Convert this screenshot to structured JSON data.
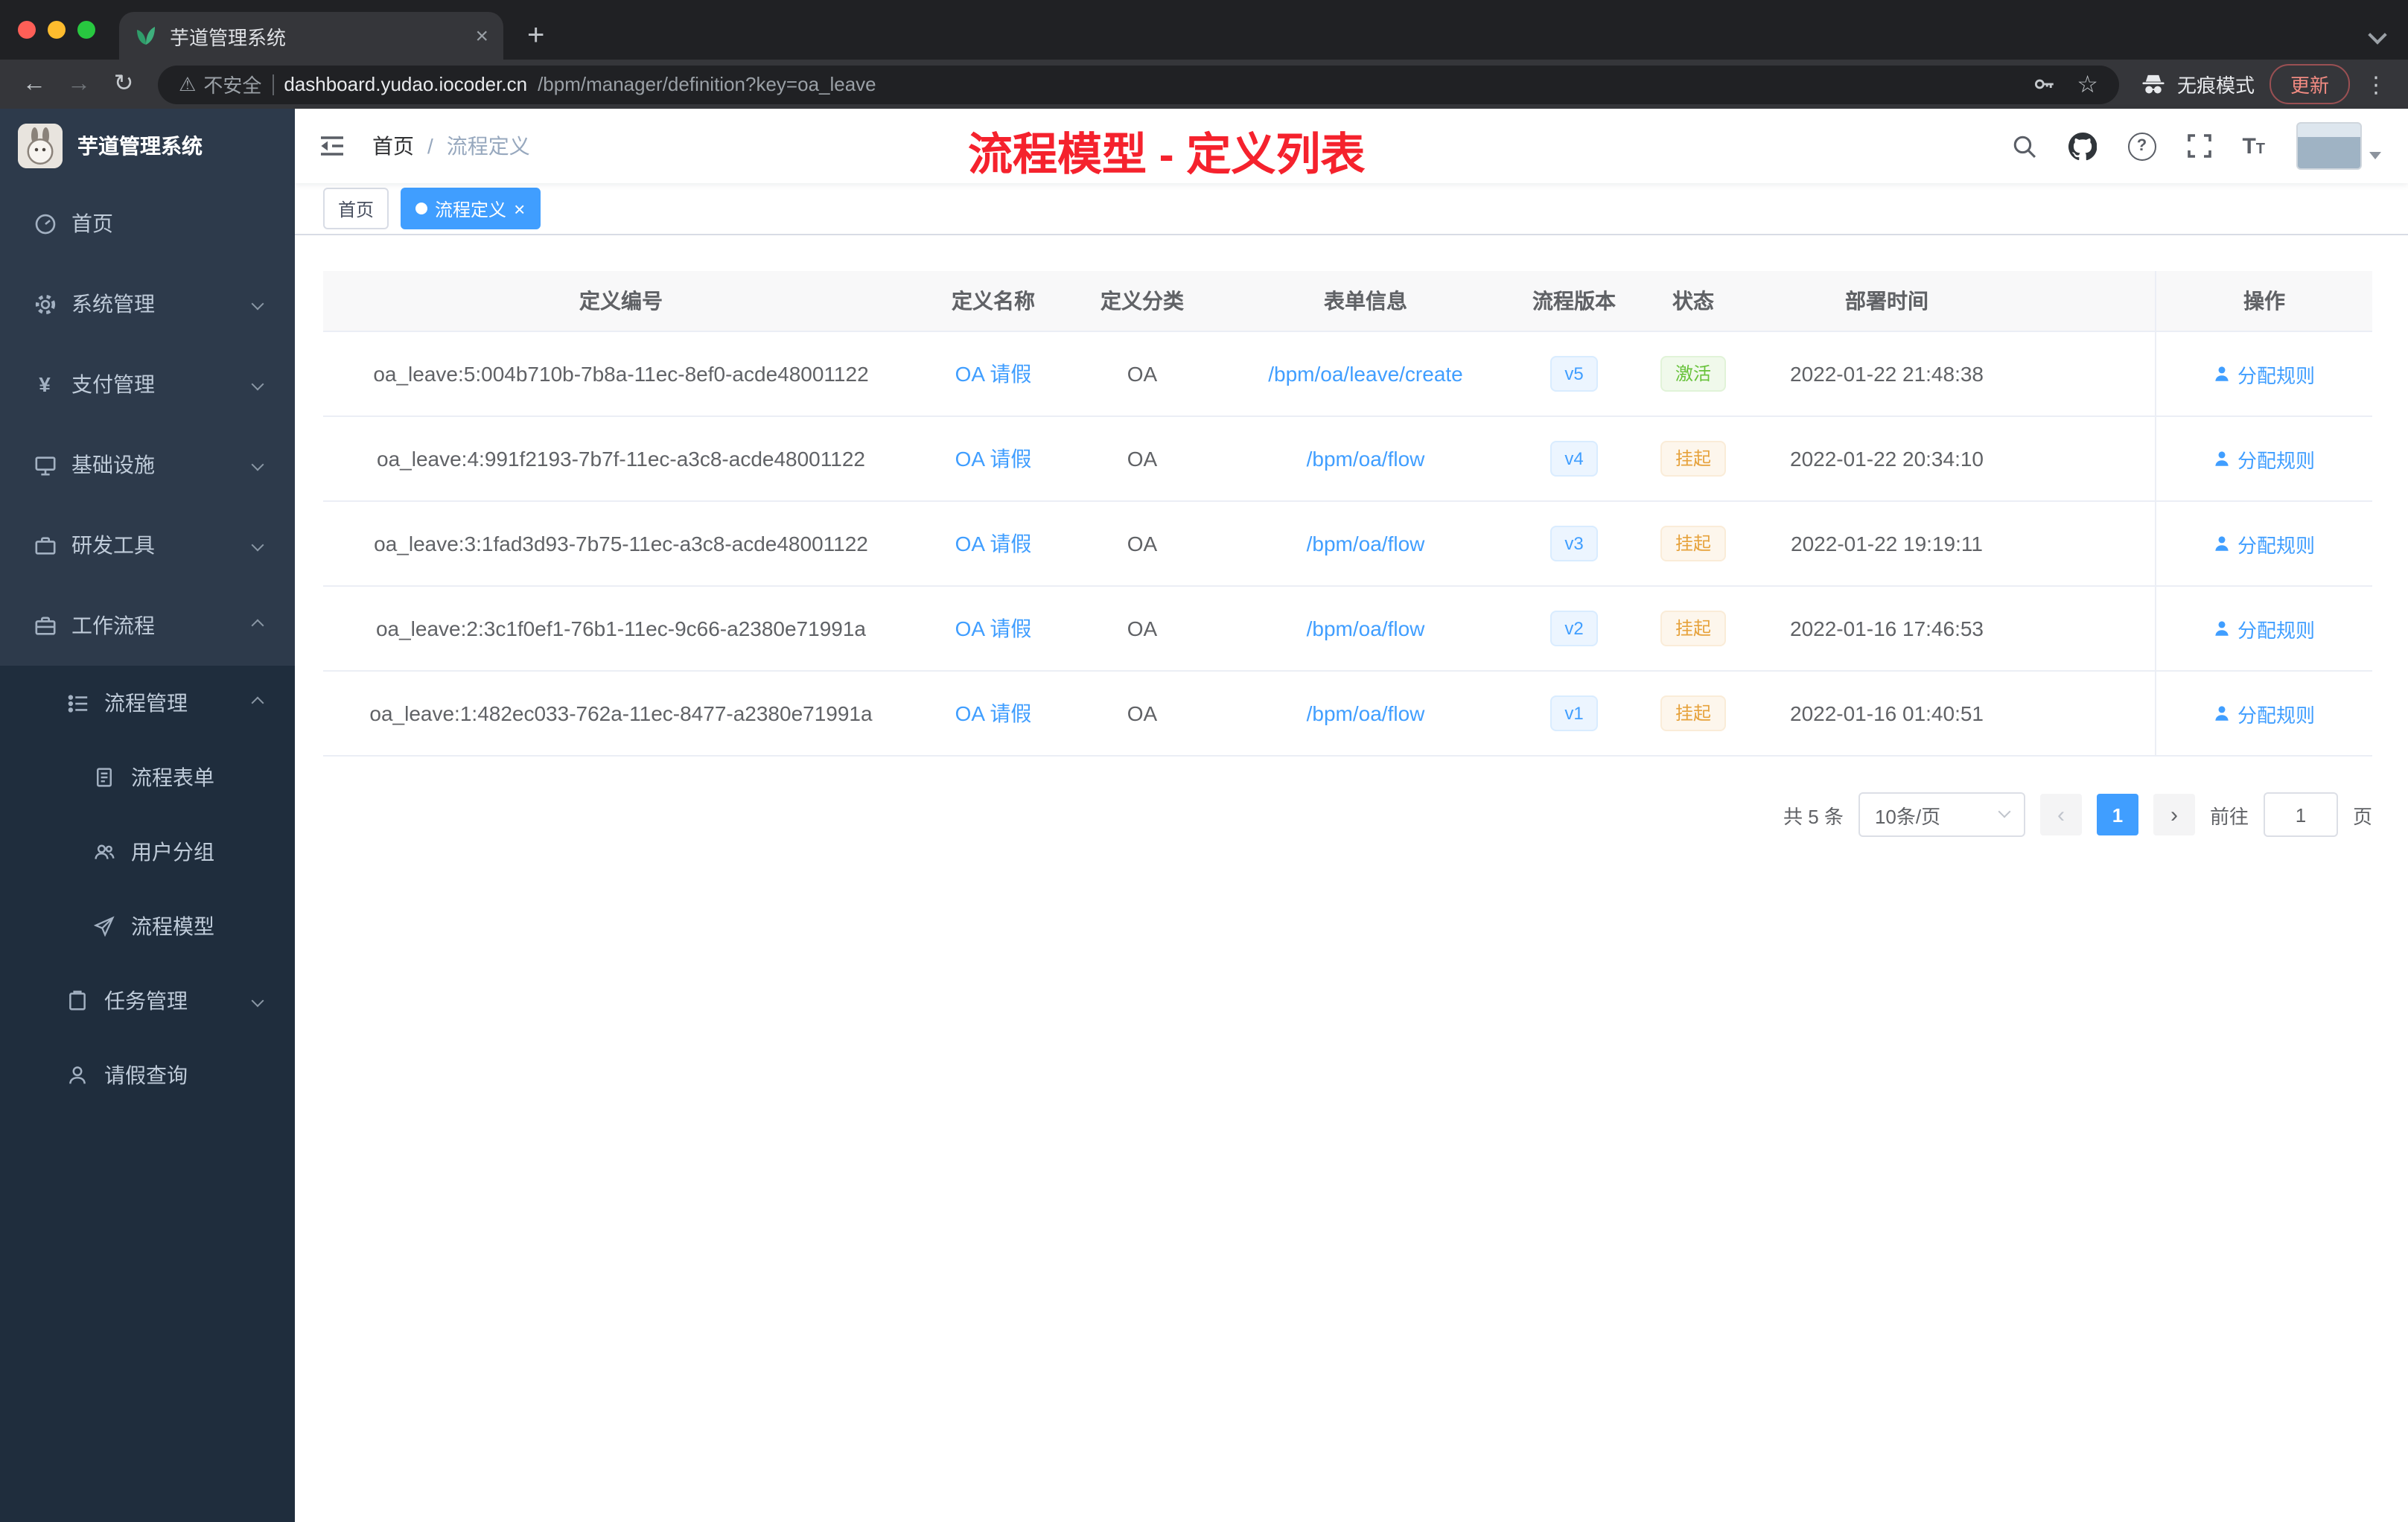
{
  "browser": {
    "tab_title": "芋道管理系统",
    "security_warning": "不安全",
    "url_host": "dashboard.yudao.iocoder.cn",
    "url_path": "/bpm/manager/definition?key=oa_leave",
    "incognito_label": "无痕模式",
    "update_label": "更新"
  },
  "icons": {
    "back": "←",
    "forward": "→",
    "reload": "↻",
    "warning": "⚠",
    "star": "☆",
    "more": "⋮",
    "close": "×",
    "new_tab": "+",
    "prev": "‹",
    "next": "›",
    "payment": "¥",
    "help": "?",
    "text_size_large": "T",
    "text_size_small": "T"
  },
  "sidebar": {
    "title": "芋道管理系统",
    "items": [
      {
        "label": "首页"
      },
      {
        "label": "系统管理"
      },
      {
        "label": "支付管理"
      },
      {
        "label": "基础设施"
      },
      {
        "label": "研发工具"
      },
      {
        "label": "工作流程"
      },
      {
        "label": "流程管理"
      },
      {
        "label": "流程表单"
      },
      {
        "label": "用户分组"
      },
      {
        "label": "流程模型"
      },
      {
        "label": "任务管理"
      },
      {
        "label": "请假查询"
      }
    ]
  },
  "header": {
    "breadcrumb_home": "首页",
    "breadcrumb_sep": "/",
    "breadcrumb_current": "流程定义",
    "overlay_title": "流程模型 - 定义列表"
  },
  "tags": {
    "home": "首页",
    "current": "流程定义"
  },
  "table": {
    "headers": [
      "定义编号",
      "定义名称",
      "定义分类",
      "表单信息",
      "流程版本",
      "状态",
      "部署时间",
      "操作"
    ],
    "rows": [
      {
        "id": "oa_leave:5:004b710b-7b8a-11ec-8ef0-acde48001122",
        "name": "OA 请假",
        "category": "OA",
        "form": "/bpm/oa/leave/create",
        "version": "v5",
        "status": "激活",
        "time": "2022-01-22 21:48:38",
        "action": "分配规则"
      },
      {
        "id": "oa_leave:4:991f2193-7b7f-11ec-a3c8-acde48001122",
        "name": "OA 请假",
        "category": "OA",
        "form": "/bpm/oa/flow",
        "version": "v4",
        "status": "挂起",
        "time": "2022-01-22 20:34:10",
        "action": "分配规则"
      },
      {
        "id": "oa_leave:3:1fad3d93-7b75-11ec-a3c8-acde48001122",
        "name": "OA 请假",
        "category": "OA",
        "form": "/bpm/oa/flow",
        "version": "v3",
        "status": "挂起",
        "time": "2022-01-22 19:19:11",
        "action": "分配规则"
      },
      {
        "id": "oa_leave:2:3c1f0ef1-76b1-11ec-9c66-a2380e71991a",
        "name": "OA 请假",
        "category": "OA",
        "form": "/bpm/oa/flow",
        "version": "v2",
        "status": "挂起",
        "time": "2022-01-16 17:46:53",
        "action": "分配规则"
      },
      {
        "id": "oa_leave:1:482ec033-762a-11ec-8477-a2380e71991a",
        "name": "OA 请假",
        "category": "OA",
        "form": "/bpm/oa/flow",
        "version": "v1",
        "status": "挂起",
        "time": "2022-01-16 01:40:51",
        "action": "分配规则"
      }
    ]
  },
  "pagination": {
    "total": "共 5 条",
    "page_size": "10条/页",
    "current_page": "1",
    "goto_label": "前往",
    "goto_value": "1",
    "page_unit": "页"
  },
  "colors": {
    "accent": "#409eff",
    "annotation_red": "#f5222d",
    "success": "#67c23a",
    "warning": "#e6a23c",
    "sidebar_bg": "#2d3a4b",
    "submenu_bg": "#1f2d3d"
  }
}
